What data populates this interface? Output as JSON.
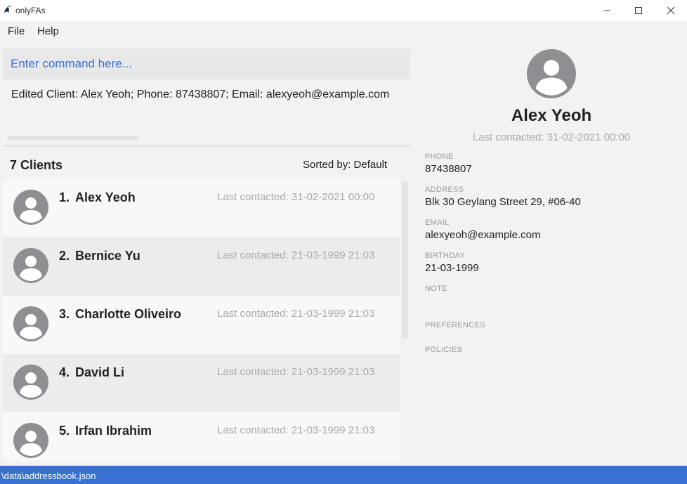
{
  "window": {
    "title": "onlyFAs"
  },
  "menu": {
    "file": "File",
    "help": "Help"
  },
  "command": {
    "placeholder": "Enter command here..."
  },
  "result": {
    "text": "Edited Client: Alex Yeoh; Phone: 87438807; Email: alexyeoh@example.com"
  },
  "list_header": {
    "count": "7 Clients",
    "sorted_by": "Sorted by: Default"
  },
  "clients": [
    {
      "index": "1.",
      "name": "Alex Yeoh",
      "last_contacted": "Last contacted: 31-02-2021 00:00"
    },
    {
      "index": "2.",
      "name": "Bernice Yu",
      "last_contacted": "Last contacted: 21-03-1999 21:03"
    },
    {
      "index": "3.",
      "name": "Charlotte Oliveiro",
      "last_contacted": "Last contacted: 21-03-1999 21:03"
    },
    {
      "index": "4.",
      "name": "David Li",
      "last_contacted": "Last contacted: 21-03-1999 21:03"
    },
    {
      "index": "5.",
      "name": "Irfan Ibrahim",
      "last_contacted": "Last contacted: 21-03-1999 21:03"
    }
  ],
  "detail": {
    "name": "Alex Yeoh",
    "last_contacted": "Last contacted: 31-02-2021 00:00",
    "phone_label": "PHONE",
    "phone": "87438807",
    "address_label": "ADDRESS",
    "address": "Blk 30 Geylang Street 29, #06-40",
    "email_label": "EMAIL",
    "email": "alexyeoh@example.com",
    "birthday_label": "BIRTHDAY",
    "birthday": "21-03-1999",
    "note_label": "NOTE",
    "preferences_label": "PREFERENCES",
    "policies_label": "POLICIES"
  },
  "status": {
    "path": "\\data\\addressbook.json"
  },
  "icons": {
    "app": "app-logo-icon",
    "minimize": "minimize-icon",
    "maximize": "maximize-icon",
    "close": "close-icon",
    "avatar": "user-avatar-icon"
  },
  "colors": {
    "accent": "#3a6fd3",
    "muted": "#a9a9a9",
    "avatar": "#8e8e93"
  }
}
